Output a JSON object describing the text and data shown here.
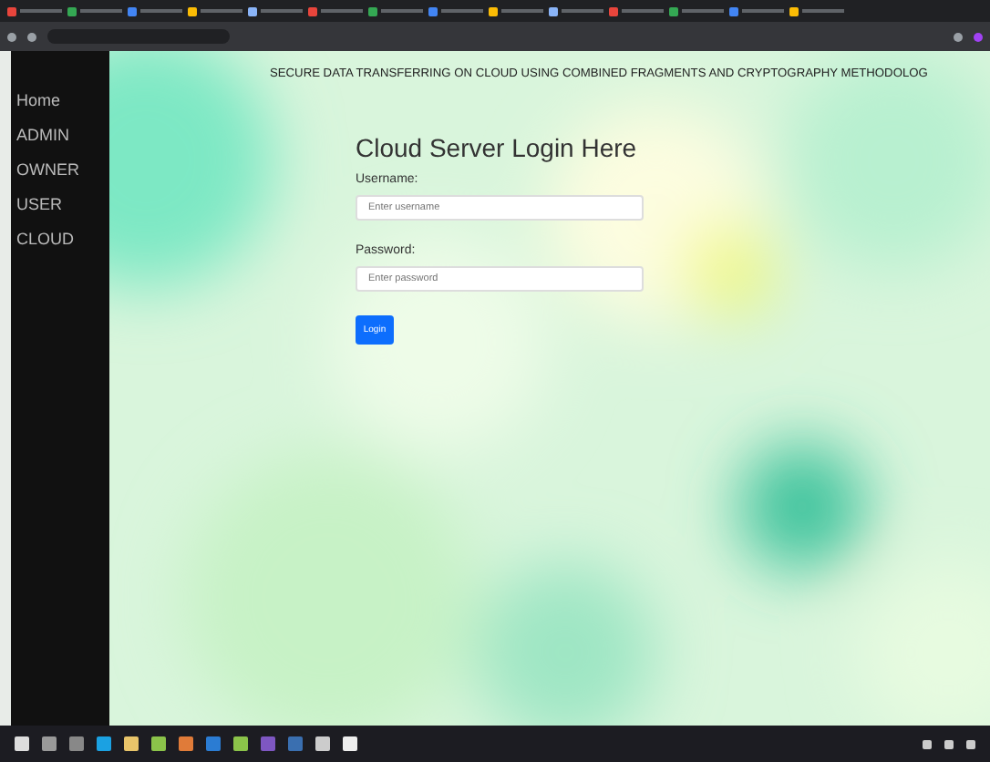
{
  "header": {
    "title": "SECURE DATA TRANSFERRING ON CLOUD USING COMBINED FRAGMENTS AND CRYPTOGRAPHY METHODOLOG"
  },
  "sidebar": {
    "items": [
      {
        "label": "Home"
      },
      {
        "label": "ADMIN"
      },
      {
        "label": "OWNER"
      },
      {
        "label": "USER"
      },
      {
        "label": "CLOUD"
      }
    ]
  },
  "login": {
    "heading": "Cloud Server Login Here",
    "fields": [
      {
        "label": "Username:",
        "placeholder": "Enter username"
      },
      {
        "label": "Password:",
        "placeholder": "Enter password"
      }
    ],
    "button": "Login"
  }
}
